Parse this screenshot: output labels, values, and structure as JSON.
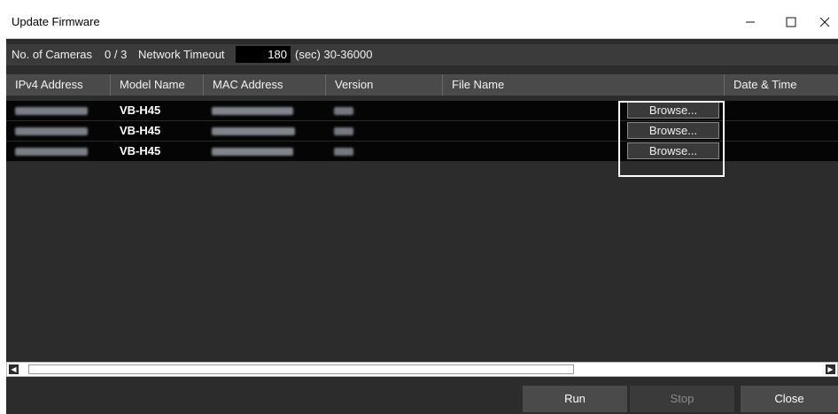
{
  "window": {
    "title": "Update Firmware",
    "icons": {
      "minimize": "minimize-icon",
      "maximize": "maximize-icon",
      "close": "close-icon"
    }
  },
  "info": {
    "cameras_label": "No. of Cameras",
    "cameras_value": "0 / 3",
    "timeout_label": "Network Timeout",
    "timeout_value": "180",
    "timeout_hint": "(sec) 30-36000"
  },
  "table": {
    "columns": [
      "IPv4 Address",
      "Model Name",
      "MAC Address",
      "Version",
      "File Name",
      "Date & Time"
    ],
    "rows": [
      {
        "model": "VB-H45",
        "browse": "Browse..."
      },
      {
        "model": "VB-H45",
        "browse": "Browse..."
      },
      {
        "model": "VB-H45",
        "browse": "Browse..."
      }
    ]
  },
  "buttons": {
    "run": "Run",
    "stop": "Stop",
    "close": "Close"
  },
  "colors": {
    "background": "#2c2c2c",
    "row": "#050505",
    "header": "#4a4a4a"
  }
}
